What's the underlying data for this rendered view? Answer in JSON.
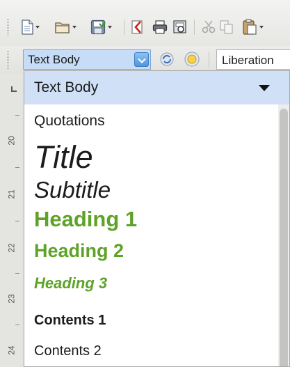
{
  "colors": {
    "heading_green": "#5ea228",
    "selection_bg": "#cfe0f7",
    "combo_bg": "#c7dcf6"
  },
  "toolbar": {
    "buttons": [
      {
        "name": "new-document",
        "icon": "new-document-icon",
        "has_dropdown": true
      },
      {
        "name": "open",
        "icon": "folder-open-icon",
        "has_dropdown": true
      },
      {
        "name": "save",
        "icon": "save-icon",
        "has_dropdown": true
      },
      {
        "name": "export-pdf",
        "icon": "pdf-export-icon",
        "has_dropdown": false
      },
      {
        "name": "print",
        "icon": "printer-icon",
        "has_dropdown": false
      },
      {
        "name": "print-preview",
        "icon": "print-preview-icon",
        "has_dropdown": false
      },
      {
        "name": "cut",
        "icon": "scissors-icon",
        "has_dropdown": false
      },
      {
        "name": "copy",
        "icon": "copy-icon",
        "has_dropdown": false
      },
      {
        "name": "paste",
        "icon": "paste-icon",
        "has_dropdown": true
      }
    ]
  },
  "formatting": {
    "paragraph_style_value": "Text Body",
    "update_style_icon": "update-style-icon",
    "new_style_icon": "new-style-icon",
    "font_name_value": "Liberation"
  },
  "ruler": {
    "numbers": [
      "20",
      "21",
      "22",
      "23",
      "24"
    ]
  },
  "style_list": {
    "selected": "Text Body",
    "items": [
      {
        "label": "Quotations"
      },
      {
        "label": "Title"
      },
      {
        "label": "Subtitle"
      },
      {
        "label": "Heading 1"
      },
      {
        "label": "Heading 2"
      },
      {
        "label": "Heading 3"
      },
      {
        "label": "Contents 1"
      },
      {
        "label": "Contents 2"
      }
    ]
  }
}
